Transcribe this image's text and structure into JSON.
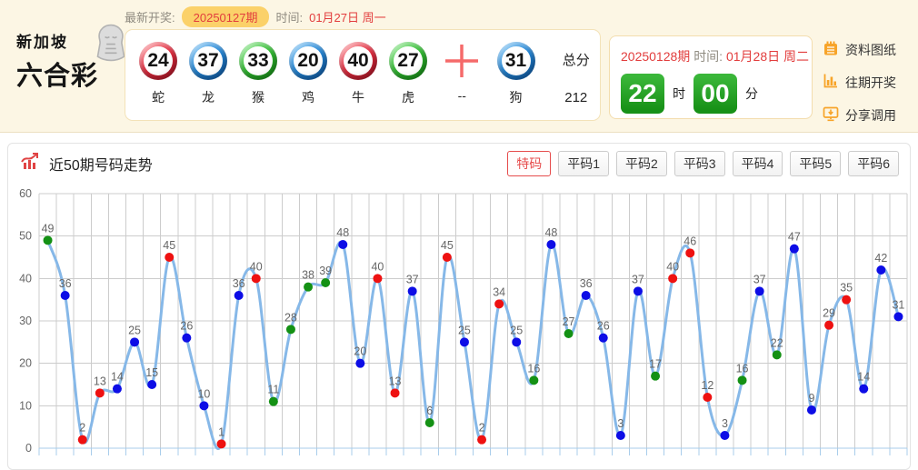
{
  "header": {
    "logo": {
      "line1": "新加坡",
      "line2": "六合彩"
    },
    "latest_label": "最新开奖:",
    "latest_issue": "20250127期",
    "time_label": "时间:",
    "latest_time": "01月27日 周一",
    "balls": [
      {
        "num": "24",
        "zodiac": "蛇",
        "color": "red"
      },
      {
        "num": "37",
        "zodiac": "龙",
        "color": "blue"
      },
      {
        "num": "33",
        "zodiac": "猴",
        "color": "green"
      },
      {
        "num": "20",
        "zodiac": "鸡",
        "color": "blue"
      },
      {
        "num": "40",
        "zodiac": "牛",
        "color": "red"
      },
      {
        "num": "27",
        "zodiac": "虎",
        "color": "green"
      }
    ],
    "separator": {
      "symbol": "+",
      "zodiac": "--"
    },
    "extra_ball": {
      "num": "31",
      "zodiac": "狗",
      "color": "blue"
    },
    "total": {
      "label": "总分",
      "value": "212"
    },
    "next": {
      "issue": "20250128期",
      "time_label": "时间:",
      "date": "01月28日 周二",
      "hour": "22",
      "hour_unit": "时",
      "minute": "00",
      "minute_unit": "分"
    },
    "links": [
      {
        "label": "资料图纸",
        "icon": "notebook-icon"
      },
      {
        "label": "往期开奖",
        "icon": "bar-chart-icon"
      },
      {
        "label": "分享调用",
        "icon": "share-monitor-icon"
      }
    ]
  },
  "chart_section": {
    "title": "近50期号码走势",
    "tabs": [
      {
        "label": "特码",
        "active": true
      },
      {
        "label": "平码1",
        "active": false
      },
      {
        "label": "平码2",
        "active": false
      },
      {
        "label": "平码3",
        "active": false
      },
      {
        "label": "平码4",
        "active": false
      },
      {
        "label": "平码5",
        "active": false
      },
      {
        "label": "平码6",
        "active": false
      }
    ]
  },
  "chart_data": {
    "type": "line",
    "title": "近50期号码走势",
    "xlabel": "",
    "ylabel": "",
    "ylim": [
      0,
      60
    ],
    "yticks": [
      0,
      10,
      20,
      30,
      40,
      50,
      60
    ],
    "grid": true,
    "legend": "none",
    "series": [
      {
        "name": "特码",
        "values": [
          49,
          36,
          2,
          13,
          14,
          25,
          15,
          45,
          26,
          10,
          1,
          36,
          40,
          11,
          28,
          38,
          39,
          48,
          20,
          40,
          13,
          37,
          6,
          45,
          25,
          2,
          34,
          25,
          16,
          48,
          27,
          36,
          26,
          3,
          37,
          17,
          40,
          46,
          12,
          3,
          16,
          37,
          22,
          47,
          9,
          29,
          35,
          14,
          42,
          31
        ],
        "point_colors": [
          "green",
          "blue",
          "red",
          "red",
          "blue",
          "blue",
          "blue",
          "red",
          "blue",
          "blue",
          "red",
          "blue",
          "red",
          "green",
          "green",
          "green",
          "green",
          "blue",
          "blue",
          "red",
          "red",
          "blue",
          "green",
          "red",
          "blue",
          "red",
          "red",
          "blue",
          "green",
          "blue",
          "green",
          "blue",
          "blue",
          "blue",
          "blue",
          "green",
          "red",
          "red",
          "red",
          "blue",
          "green",
          "blue",
          "green",
          "blue",
          "blue",
          "red",
          "red",
          "blue",
          "blue",
          "blue"
        ]
      }
    ]
  },
  "colors": {
    "red": "#ee1111",
    "blue": "#0d0de6",
    "green": "#149114",
    "line": "#86b8e8",
    "grid": "#cccccc",
    "axis": "#a9cdeb",
    "label": "#666666",
    "accent": "#e23d3d",
    "icon_orange": "#f7a429"
  }
}
